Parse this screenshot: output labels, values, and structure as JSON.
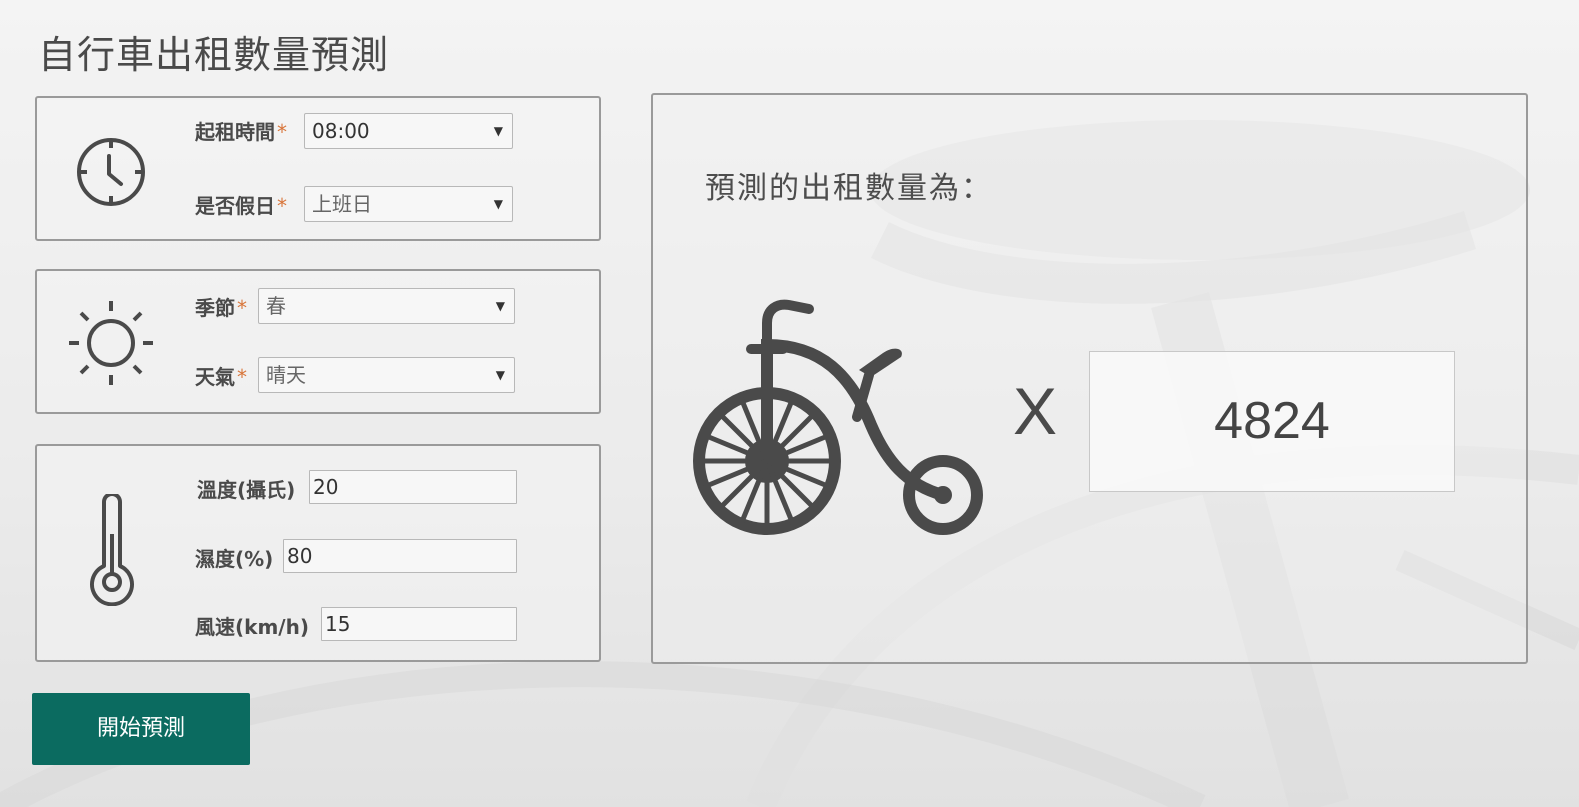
{
  "header": {
    "title": "自行車出租數量預測"
  },
  "time_panel": {
    "icon": "clock-icon",
    "start_time_label": "起租時間",
    "start_time_value": "08:00",
    "holiday_label": "是否假日",
    "holiday_value": "上班日"
  },
  "weather_panel": {
    "icon": "sun-icon",
    "season_label": "季節",
    "season_value": "春",
    "weather_label": "天氣",
    "weather_value": "晴天"
  },
  "climate_panel": {
    "icon": "thermometer-icon",
    "temperature_label": "溫度(攝氏)",
    "temperature_value": "20",
    "humidity_label": "濕度(%)",
    "humidity_value": "80",
    "wind_label": "風速(km/h)",
    "wind_value": "15"
  },
  "required_marker": "*",
  "result_panel": {
    "label": "預測的出租數量為：",
    "icon": "penny-farthing-bicycle-icon",
    "multiplier": "X",
    "count": "4824"
  },
  "actions": {
    "predict_label": "開始預測"
  },
  "colors": {
    "accent": "#0b6b60",
    "required": "#d8753a",
    "border": "#9a9a9a",
    "text": "#4a4a4a"
  }
}
